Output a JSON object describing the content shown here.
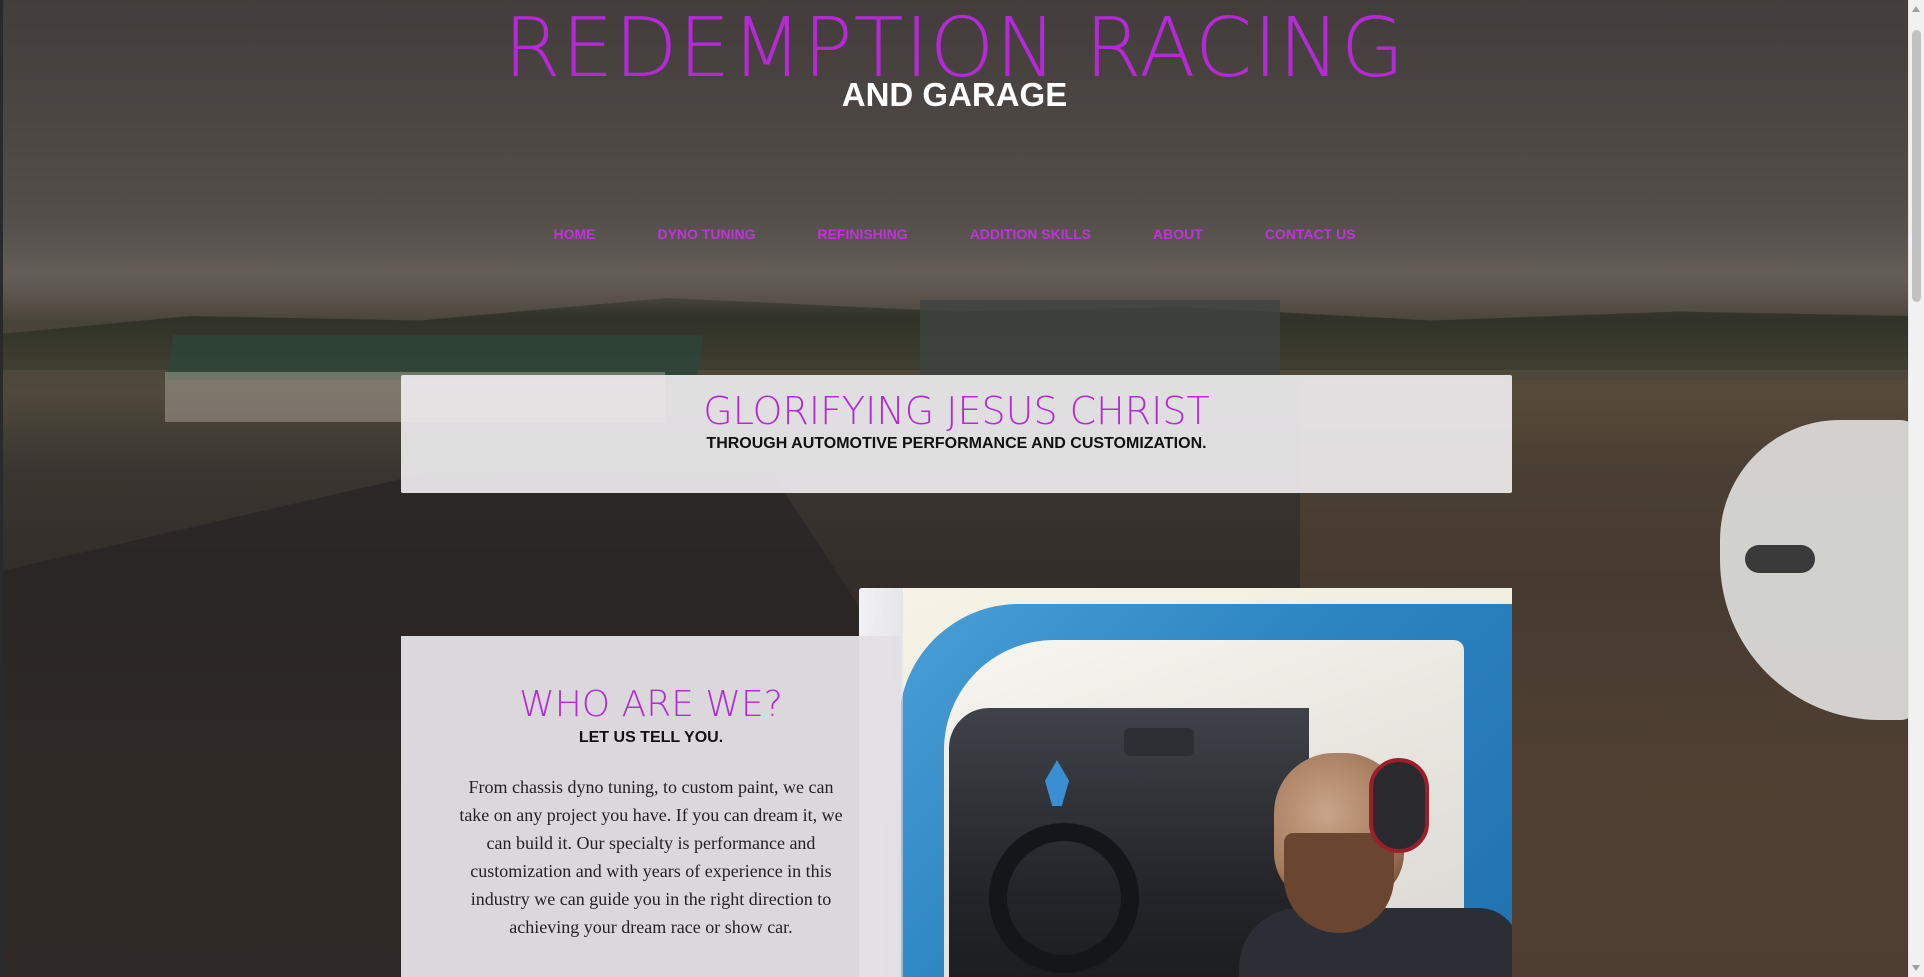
{
  "header": {
    "title": "REDEMPTION RACING",
    "subtitle": "AND GARAGE"
  },
  "nav": {
    "items": [
      {
        "label": "HOME"
      },
      {
        "label": "DYNO TUNING"
      },
      {
        "label": "REFINISHING"
      },
      {
        "label": "ADDITION SKILLS"
      },
      {
        "label": "ABOUT"
      },
      {
        "label": "CONTACT US"
      }
    ]
  },
  "mission": {
    "title": "GLORIFYING JESUS CHRIST",
    "subtitle": "THROUGH AUTOMOTIVE PERFORMANCE AND CUSTOMIZATION."
  },
  "about": {
    "title": "WHO ARE WE?",
    "subtitle": "LET US TELL YOU.",
    "body": "From chassis dyno tuning, to custom paint, we can take on any project you have. If you can dream it, we can build it. Our specialty is performance and customization and with years of experience in this industry we can guide you in the right direction to achieving your dream race or show car."
  },
  "colors": {
    "accent": "#b52ad6",
    "nav": "#c132dc",
    "panel": "#ecebed"
  },
  "icons": {
    "scroll_up": "chevron-up-icon",
    "scroll_down": "chevron-down-icon"
  }
}
